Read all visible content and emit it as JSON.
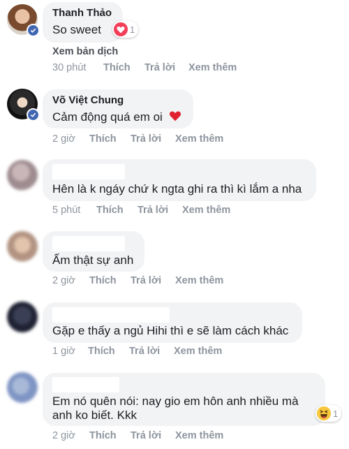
{
  "colors": {
    "like_blue": "#4267b2",
    "heart_red": "#f33e58",
    "meta_gray": "#8d949e",
    "bubble_bg": "#f2f3f5"
  },
  "comments": [
    {
      "author": "Thanh Thảo",
      "text": "So sweet",
      "reaction": {
        "icon": "heart-icon",
        "count": "1"
      },
      "translate": "Xem bản dịch",
      "time": "30 phút",
      "like": "Thích",
      "reply": "Trả lời",
      "more": "Xem thêm"
    },
    {
      "author": "Võ Việt Chung",
      "text": "Cảm động quá em oi",
      "emoji": "heart-emoji-icon",
      "time": "2 giờ",
      "like": "Thích",
      "reply": "Trả lời",
      "more": "Xem thêm"
    },
    {
      "author": "",
      "text": "Hên là k ngáy chứ k ngta ghi ra thì kì lắm a nha",
      "time": "5 phút",
      "like": "Thích",
      "reply": "Trả lời",
      "more": "Xem thêm"
    },
    {
      "author": "",
      "text": "Ấm thật sự anh",
      "time": "2 giờ",
      "like": "Thích",
      "reply": "Trả lời",
      "more": "Xem thêm"
    },
    {
      "author": "",
      "text": "Gặp e thấy a ngủ Hihi thì e sẽ làm cách khác",
      "time": "1 giờ",
      "like": "Thích",
      "reply": "Trả lời",
      "more": "Xem thêm"
    },
    {
      "author": "",
      "text_line1": "Em nó quên nói: nay gio em hôn anh nhiều mà",
      "text_line2": "anh ko biết. Kkk",
      "reaction": {
        "icon": "haha-icon",
        "count": "1"
      },
      "time": "2 giờ",
      "like": "Thích",
      "reply": "Trả lời",
      "more": "Xem thêm"
    }
  ]
}
